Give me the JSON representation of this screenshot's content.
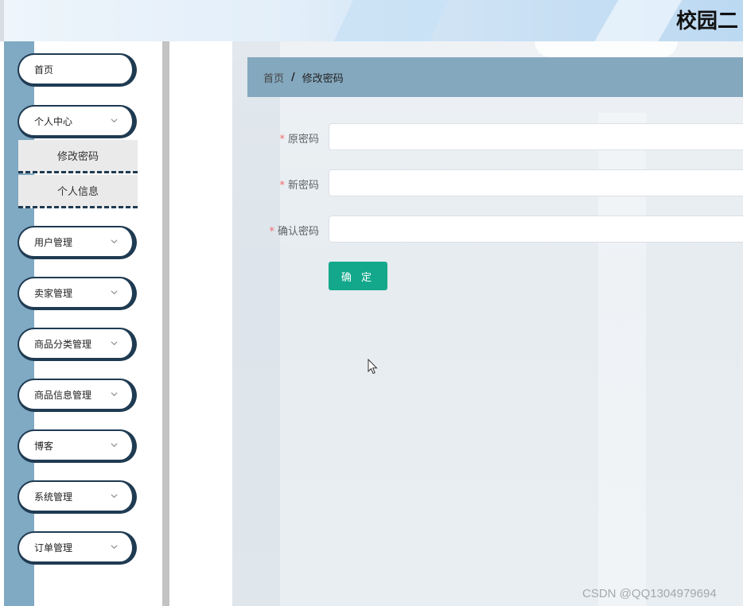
{
  "app": {
    "title": "校园二"
  },
  "sidebar": {
    "home": "首页",
    "personal_center": {
      "label": "个人中心",
      "submenu": [
        "修改密码",
        "个人信息"
      ]
    },
    "items": [
      "用户管理",
      "卖家管理",
      "商品分类管理",
      "商品信息管理",
      "博客",
      "系统管理",
      "订单管理"
    ]
  },
  "breadcrumb": {
    "home": "首页",
    "separator": "/",
    "current": "修改密码"
  },
  "form": {
    "required_mark": "*",
    "old_password_label": "原密码",
    "new_password_label": "新密码",
    "confirm_password_label": "确认密码",
    "old_password_value": "",
    "new_password_value": "",
    "confirm_password_value": "",
    "submit_label": "确 定"
  },
  "watermark": "CSDN @QQ1304979694",
  "colors": {
    "sidebar_accent": "#80a9c3",
    "pill_border": "#1f3b52",
    "breadcrumb_bg": "#84a8be",
    "primary_button": "#13a88c",
    "required": "#f56c6c"
  }
}
